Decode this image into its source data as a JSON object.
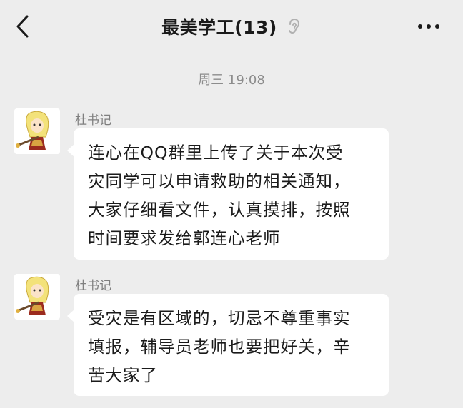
{
  "header": {
    "title": "最美学工(13)",
    "back_icon": "chevron-left-icon",
    "ear_icon": "ear-icon",
    "more_icon": "more-dots-icon"
  },
  "chat": {
    "timestamp": "周三 19:08",
    "messages": [
      {
        "sender": "杜书记",
        "lines": [
          "连心在QQ群里上传了关于本次受",
          "灾同学可以申请救助的相关通知，",
          "大家仔细看文件，认真摸排，按照",
          "时间要求发给郭连心老师"
        ]
      },
      {
        "sender": "杜书记",
        "lines": [
          "受灾是有区域的，切忌不尊重事实",
          "填报，辅导员老师也要把好关，辛",
          "苦大家了"
        ]
      }
    ]
  }
}
